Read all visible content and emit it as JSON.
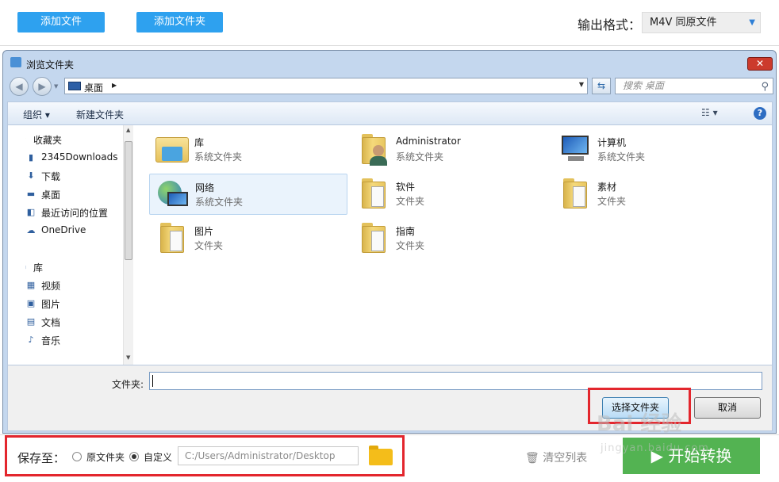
{
  "app": {
    "add_file": "添加文件",
    "add_folder": "添加文件夹",
    "output_label": "输出格式：",
    "output_value": "M4V  同原文件"
  },
  "dialog": {
    "title": "浏览文件夹",
    "close": "✕",
    "address": "桌面",
    "search_placeholder": "搜索 桌面",
    "toolbar": {
      "organize": "组织 ▾",
      "new_folder": "新建文件夹"
    },
    "nav": [
      {
        "icon": "star-icon",
        "glyph": "★",
        "label": "收藏夹",
        "group": true
      },
      {
        "icon": "folder-icon",
        "glyph": "▮",
        "label": "2345Downloads"
      },
      {
        "icon": "download-icon",
        "glyph": "⬇",
        "label": "下载"
      },
      {
        "icon": "desktop-icon",
        "glyph": "▬",
        "label": "桌面"
      },
      {
        "icon": "recent-places-icon",
        "glyph": "◧",
        "label": "最近访问的位置"
      },
      {
        "icon": "onedrive-icon",
        "glyph": "☁",
        "label": "OneDrive"
      },
      {
        "icon": "library-icon",
        "glyph": "▭",
        "label": "库",
        "group": true
      },
      {
        "icon": "video-icon",
        "glyph": "▦",
        "label": "视频"
      },
      {
        "icon": "picture-icon",
        "glyph": "▣",
        "label": "图片"
      },
      {
        "icon": "document-icon",
        "glyph": "▤",
        "label": "文档"
      },
      {
        "icon": "music-icon",
        "glyph": "♪",
        "label": "音乐"
      }
    ],
    "items": [
      {
        "name": "库",
        "type": "系统文件夹",
        "icon": "library-folder-icon"
      },
      {
        "name": "Administrator",
        "type": "系统文件夹",
        "icon": "user-folder-icon"
      },
      {
        "name": "计算机",
        "type": "系统文件夹",
        "icon": "computer-icon"
      },
      {
        "name": "网络",
        "type": "系统文件夹",
        "icon": "network-globe-icon"
      },
      {
        "name": "软件",
        "type": "文件夹",
        "icon": "folder-icon"
      },
      {
        "name": "素材",
        "type": "文件夹",
        "icon": "folder-icon"
      },
      {
        "name": "图片",
        "type": "文件夹",
        "icon": "folder-icon"
      },
      {
        "name": "指南",
        "type": "文件夹",
        "icon": "folder-icon"
      }
    ],
    "folder_label": "文件夹:",
    "folder_value": "",
    "select_btn": "选择文件夹",
    "cancel_btn": "取消"
  },
  "bottom": {
    "save_to": "保存至：",
    "opt_original": "原文件夹",
    "opt_custom": "自定义",
    "selected_option": "自定义",
    "path": "C:/Users/Administrator/Desktop",
    "clear_list": "清空列表",
    "start": "开始转换"
  },
  "watermark": {
    "text": "Bai 经验",
    "sub": "jingyan.baidu.com"
  },
  "colors": {
    "accent_blue": "#2ea1ef",
    "start_green": "#53b352",
    "highlight_red": "#e3262d"
  }
}
